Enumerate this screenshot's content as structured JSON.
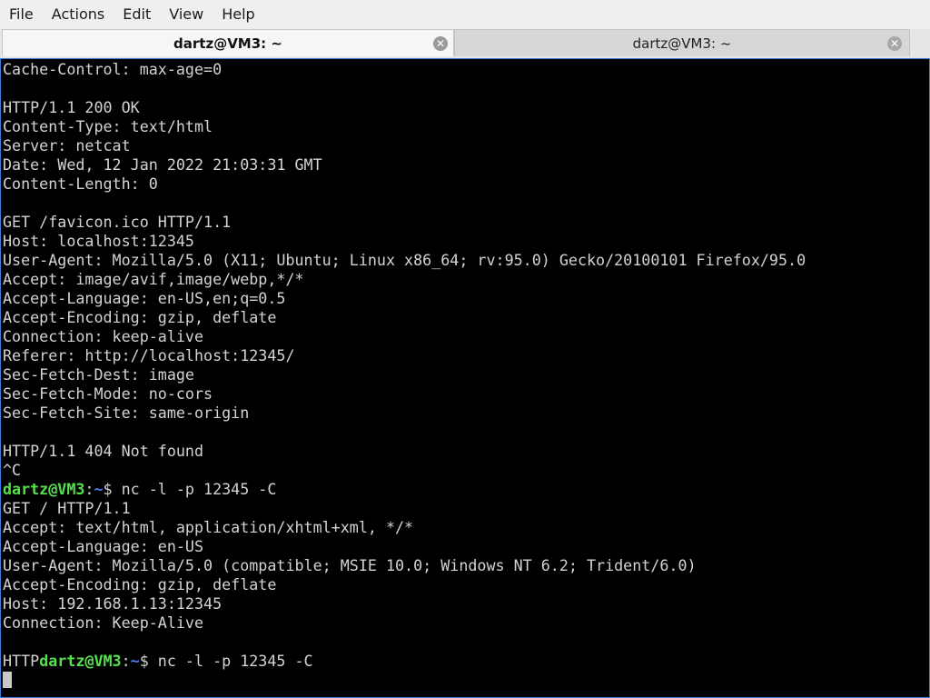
{
  "menubar": {
    "items": [
      "File",
      "Actions",
      "Edit",
      "View",
      "Help"
    ]
  },
  "tabs": [
    {
      "label": "dartz@VM3: ~",
      "active": true
    },
    {
      "label": "dartz@VM3: ~",
      "active": false
    }
  ],
  "icons": {
    "tab_close": "close-circle-icon",
    "close_glyph": "✕"
  },
  "terminal": {
    "colors": {
      "background": "#000000",
      "text": "#d3d3d3",
      "prompt_user": "#55e04e",
      "prompt_path": "#4f7ff0"
    },
    "lines": [
      {
        "text": "Cache-Control: max-age=0"
      },
      {
        "text": ""
      },
      {
        "text": "HTTP/1.1 200 OK"
      },
      {
        "text": "Content-Type: text/html"
      },
      {
        "text": "Server: netcat"
      },
      {
        "text": "Date: Wed, 12 Jan 2022 21:03:31 GMT"
      },
      {
        "text": "Content-Length: 0"
      },
      {
        "text": ""
      },
      {
        "text": "GET /favicon.ico HTTP/1.1"
      },
      {
        "text": "Host: localhost:12345"
      },
      {
        "text": "User-Agent: Mozilla/5.0 (X11; Ubuntu; Linux x86_64; rv:95.0) Gecko/20100101 Firefox/95.0"
      },
      {
        "text": "Accept: image/avif,image/webp,*/*"
      },
      {
        "text": "Accept-Language: en-US,en;q=0.5"
      },
      {
        "text": "Accept-Encoding: gzip, deflate"
      },
      {
        "text": "Connection: keep-alive"
      },
      {
        "text": "Referer: http://localhost:12345/"
      },
      {
        "text": "Sec-Fetch-Dest: image"
      },
      {
        "text": "Sec-Fetch-Mode: no-cors"
      },
      {
        "text": "Sec-Fetch-Site: same-origin"
      },
      {
        "text": ""
      },
      {
        "text": "HTTP/1.1 404 Not found"
      },
      {
        "text": "^C"
      },
      {
        "prompt": {
          "prefix": "",
          "user_host": "dartz@VM3",
          "colon": ":",
          "path": "~",
          "dollar": "$",
          "command": " nc -l -p 12345 -C"
        }
      },
      {
        "text": "GET / HTTP/1.1"
      },
      {
        "text": "Accept: text/html, application/xhtml+xml, */*"
      },
      {
        "text": "Accept-Language: en-US"
      },
      {
        "text": "User-Agent: Mozilla/5.0 (compatible; MSIE 10.0; Windows NT 6.2; Trident/6.0)"
      },
      {
        "text": "Accept-Encoding: gzip, deflate"
      },
      {
        "text": "Host: 192.168.1.13:12345"
      },
      {
        "text": "Connection: Keep-Alive"
      },
      {
        "text": ""
      },
      {
        "prompt": {
          "prefix": "HTTP",
          "user_host": "dartz@VM3",
          "colon": ":",
          "path": "~",
          "dollar": "$",
          "command": " nc -l -p 12345 -C"
        }
      },
      {
        "cursor": true
      }
    ]
  }
}
